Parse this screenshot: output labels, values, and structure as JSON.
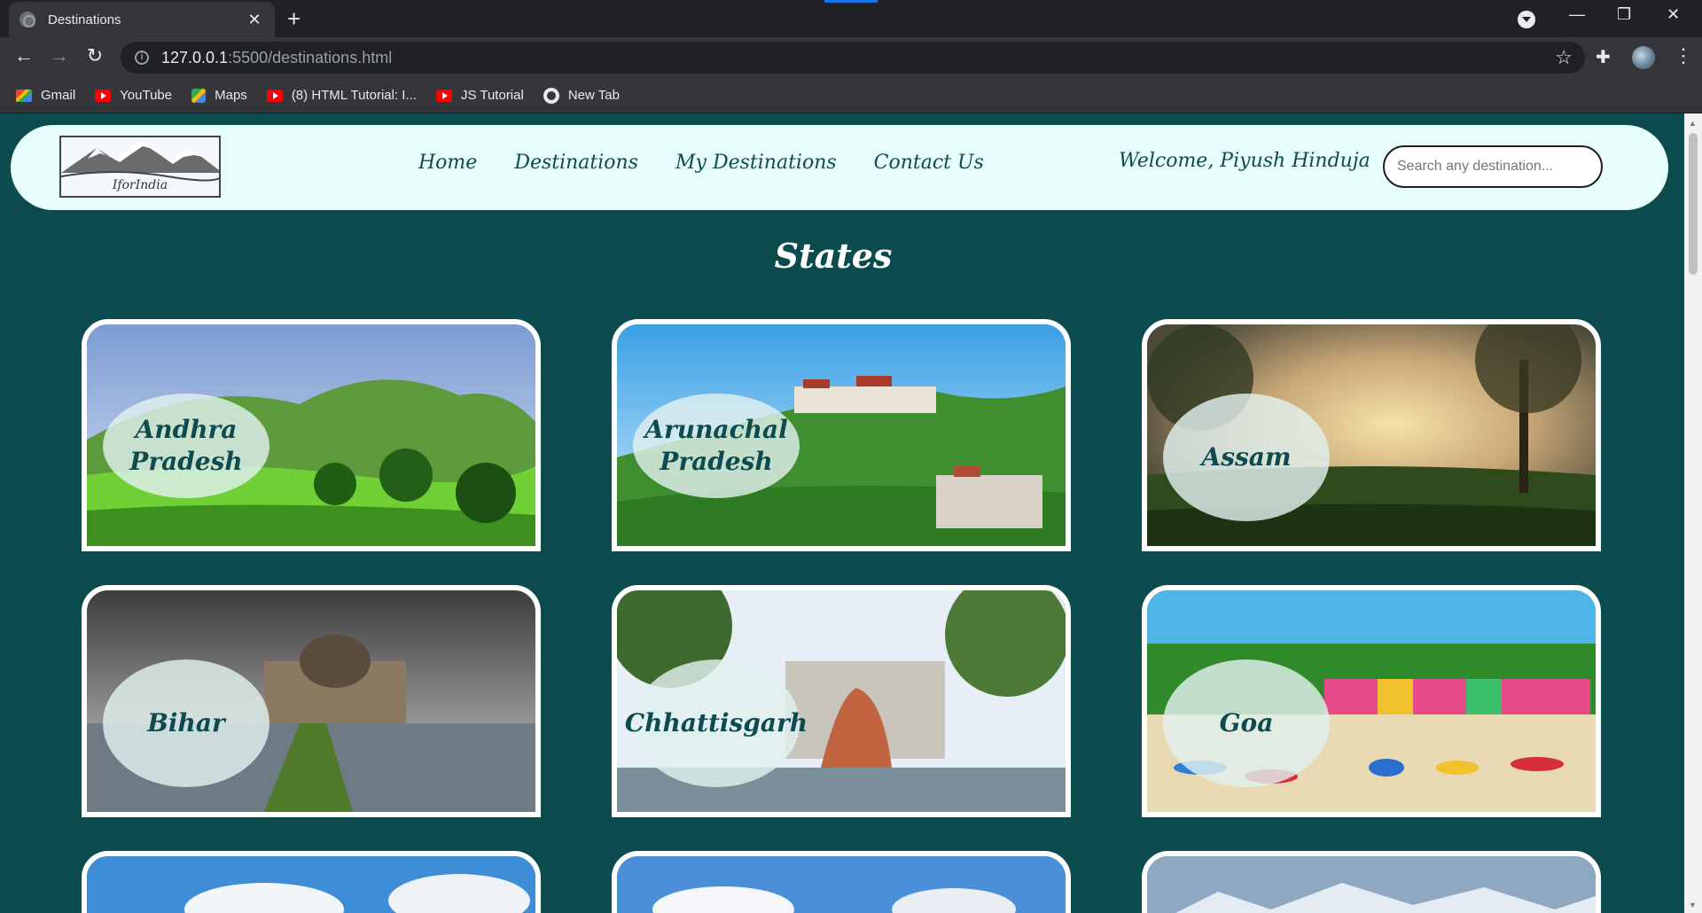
{
  "browser": {
    "tab_title": "Destinations",
    "url_host": "127.0.0.1",
    "url_path": ":5500/destinations.html",
    "bookmarks": [
      "Gmail",
      "YouTube",
      "Maps",
      "(8) HTML Tutorial: I...",
      "JS Tutorial",
      "New Tab"
    ]
  },
  "site": {
    "logo_text": "IforIndia",
    "nav": [
      "Home",
      "Destinations",
      "My Destinations",
      "Contact Us"
    ],
    "welcome": "Welcome, Piyush Hinduja",
    "search_placeholder": "Search any destination..."
  },
  "section_title": "States",
  "states": [
    {
      "name": "Andhra Pradesh"
    },
    {
      "name": "Arunachal Pradesh"
    },
    {
      "name": "Assam"
    },
    {
      "name": "Bihar"
    },
    {
      "name": "Chhattisgarh"
    },
    {
      "name": "Goa"
    }
  ],
  "colors": {
    "page_bg": "#0b4a4d",
    "nav_bg": "#e7fdfc",
    "text_dark": "#0e4b4f"
  }
}
